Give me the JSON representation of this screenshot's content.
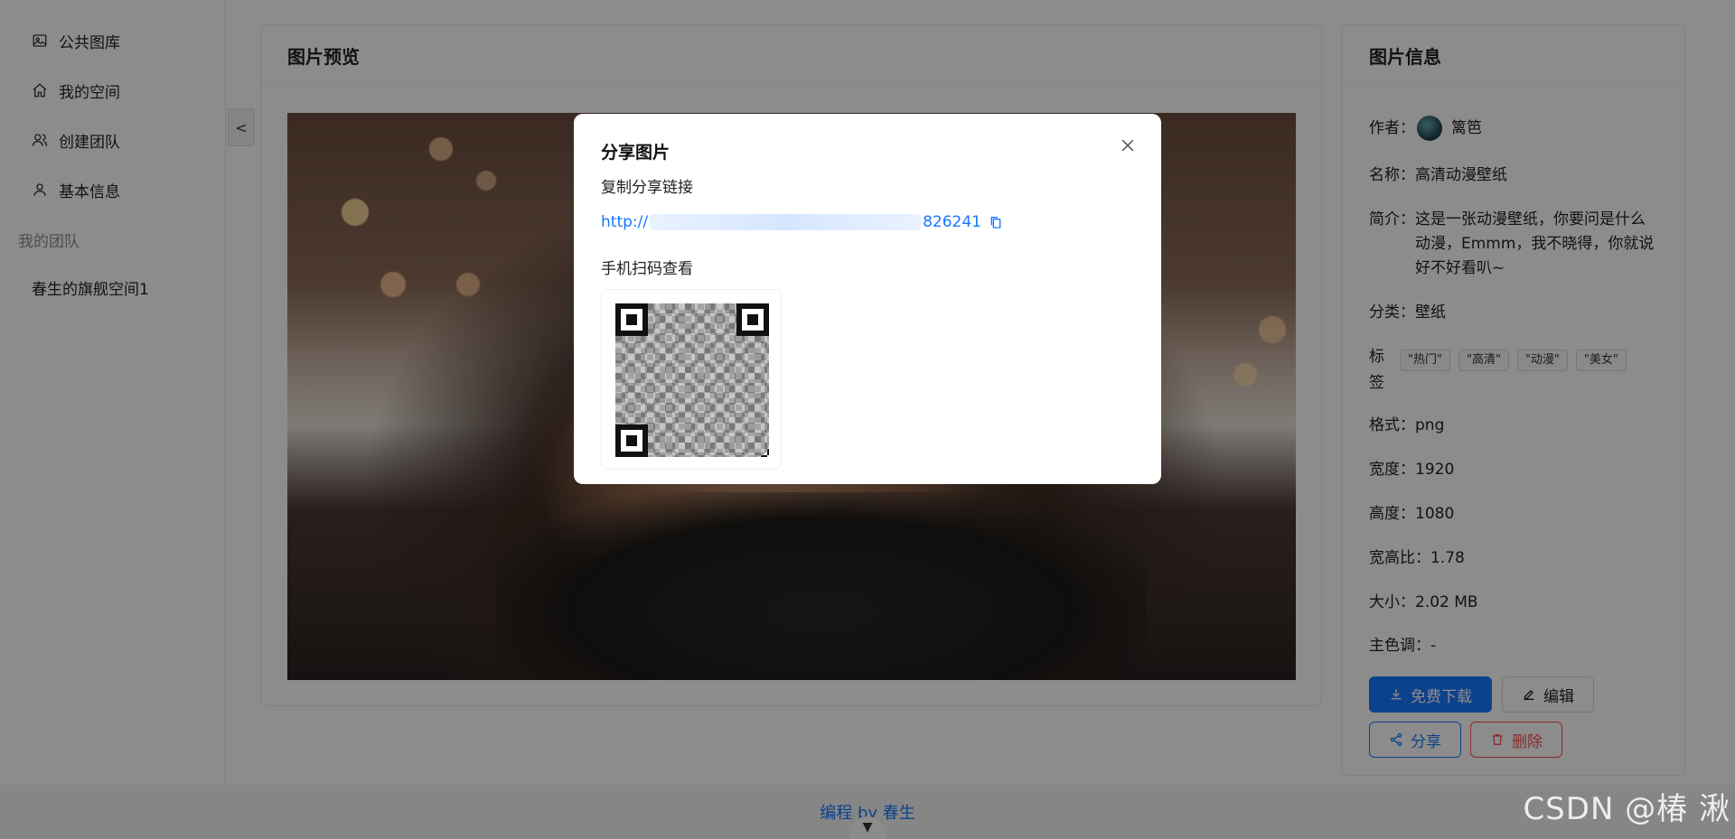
{
  "sidebar": {
    "items": [
      {
        "label": "公共图库",
        "icon": "picture-icon"
      },
      {
        "label": "我的空间",
        "icon": "home-icon"
      },
      {
        "label": "创建团队",
        "icon": "team-icon"
      },
      {
        "label": "基本信息",
        "icon": "user-icon"
      }
    ],
    "group_title": "我的团队",
    "team_item": "春生的旗舰空间1",
    "collapse_label": "<"
  },
  "preview": {
    "title": "图片预览"
  },
  "info": {
    "title": "图片信息",
    "author_label": "作者：",
    "author_name": "篱笆",
    "name_label": "名称：",
    "name_value": "高清动漫壁纸",
    "intro_label": "简介：",
    "intro_value": "这是一张动漫壁纸，你要问是什么动漫，Emmm，我不晓得，你就说好不好看叭~",
    "category_label": "分类：",
    "category_value": "壁纸",
    "tags_label": "标签",
    "tags": [
      "\"热门\"",
      "\"高清\"",
      "\"动漫\"",
      "\"美女\""
    ],
    "format_label": "格式：",
    "format_value": "png",
    "width_label": "宽度：",
    "width_value": "1920",
    "height_label": "高度：",
    "height_value": "1080",
    "ratio_label": "宽高比：",
    "ratio_value": "1.78",
    "size_label": "大小：",
    "size_value": "2.02 MB",
    "color_label": "主色调：",
    "color_value": "-",
    "buttons": {
      "download": "免费下载",
      "edit": "编辑",
      "share": "分享",
      "delete": "删除"
    }
  },
  "footer": {
    "text": "编程 by 春生"
  },
  "modal": {
    "title": "分享图片",
    "copy_label": "复制分享链接",
    "link_prefix": "http://",
    "link_suffix": "826241",
    "qr_label": "手机扫码查看"
  },
  "watermark": "CSDN @椿  湫",
  "colors": {
    "primary": "#1677ff",
    "danger": "#ff4d4f"
  }
}
